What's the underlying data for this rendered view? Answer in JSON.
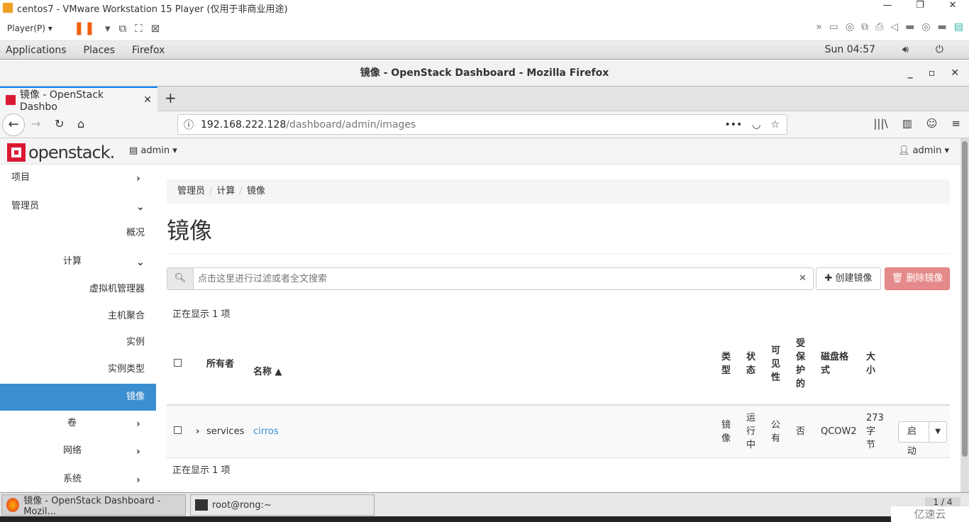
{
  "vmware": {
    "title": "centos7 - VMware Workstation 15 Player (仅用于非商业用途)",
    "menu": "Player(P) ▾",
    "window_controls": [
      "—",
      "❐",
      "✕"
    ]
  },
  "gnome": {
    "applications": "Applications",
    "places": "Places",
    "firefox": "Firefox",
    "clock": "Sun 04:57"
  },
  "firefox": {
    "window_title": "镜像 - OpenStack Dashboard - Mozilla Firefox",
    "tab_title": "镜像 - OpenStack Dashbo",
    "url_host": "192.168.222.128",
    "url_path": "/dashboard/admin/images"
  },
  "header": {
    "logo": "openstack.",
    "project": "admin",
    "user": "admin"
  },
  "sidebar": {
    "items": [
      {
        "label": "项目"
      },
      {
        "label": "管理员"
      },
      {
        "label": "概况"
      },
      {
        "label": "计算"
      },
      {
        "label": "虚拟机管理器"
      },
      {
        "label": "主机聚合"
      },
      {
        "label": "实例"
      },
      {
        "label": "实例类型"
      },
      {
        "label": "镜像"
      },
      {
        "label": "卷"
      },
      {
        "label": "网络"
      },
      {
        "label": "系统"
      }
    ]
  },
  "main": {
    "breadcrumb": [
      "管理员",
      "计算",
      "镜像"
    ],
    "title": "镜像",
    "search_placeholder": "点击这里进行过滤或者全文搜索",
    "create_label": "创建镜像",
    "delete_label": "删除镜像",
    "count_top": "正在显示 1 项",
    "count_bottom": "正在显示 1 项",
    "columns": [
      "所有者",
      "名称 ▲",
      "类型",
      "状态",
      "可见性",
      "受保护的",
      "磁盘格式",
      "大小"
    ],
    "rows": [
      {
        "owner": "services",
        "name": "cirros",
        "type": "镜像",
        "status": "运行中",
        "visibility": "公有",
        "protected": "否",
        "format": "QCOW2",
        "size": "273 字节",
        "action": "启动"
      }
    ]
  },
  "taskbar": {
    "items": [
      "镜像 - OpenStack Dashboard - Mozil...",
      "root@rong:~"
    ],
    "pager": "1 / 4"
  },
  "watermark": "亿速云",
  "colors": {
    "accent": "#3b8ed0",
    "brand": "#da1a32",
    "danger": "#e58a8a"
  }
}
